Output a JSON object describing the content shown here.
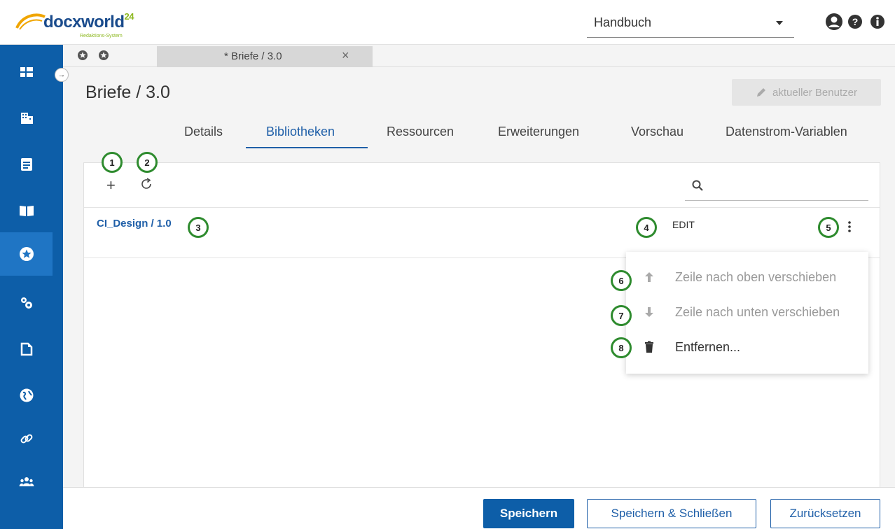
{
  "header": {
    "brand": "docxworld",
    "brand_suffix": "24",
    "tagline": "Redaktions-System",
    "project_select": "Handbuch",
    "icons": [
      "user-icon",
      "help-icon",
      "info-icon"
    ]
  },
  "sidebar": {
    "items": [
      "dashboard-icon",
      "building-icon",
      "document-icon",
      "book-icon",
      "star-icon",
      "settings-icon",
      "file-icon",
      "globe-icon",
      "link-icon",
      "users-icon"
    ],
    "active_index": 4
  },
  "tabstrip": {
    "doc_tab_label": "* Briefe / 3.0",
    "close": "×"
  },
  "page": {
    "title": "Briefe / 3.0",
    "user_button": "aktueller Benutzer"
  },
  "tabs": [
    {
      "label": "Details"
    },
    {
      "label": "Bibliotheken"
    },
    {
      "label": "Ressourcen"
    },
    {
      "label": "Erweiterungen"
    },
    {
      "label": "Vorschau"
    },
    {
      "label": "Datenstrom-Variablen"
    }
  ],
  "active_tab": "Bibliotheken",
  "toolbar": {
    "add": "+",
    "search_placeholder": ""
  },
  "row": {
    "link": "CI_Design / 1.0",
    "edit": "EDIT"
  },
  "context_menu": {
    "items": [
      {
        "label": "Zeile nach oben verschieben",
        "icon": "arrow-up-icon",
        "disabled": true
      },
      {
        "label": "Zeile nach unten verschieben",
        "icon": "arrow-down-icon",
        "disabled": true
      },
      {
        "label": "Entfernen...",
        "icon": "trash-icon",
        "disabled": false
      }
    ]
  },
  "callouts": [
    "1",
    "2",
    "3",
    "4",
    "5",
    "6",
    "7",
    "8"
  ],
  "footer": {
    "save": "Speichern",
    "save_close": "Speichern & Schließen",
    "reset": "Zurücksetzen"
  },
  "colors": {
    "primary": "#0d5ea8",
    "sidebar_active": "#1f75c4",
    "callout_ring": "#2e8b2e",
    "brand_green": "#8db81f"
  }
}
